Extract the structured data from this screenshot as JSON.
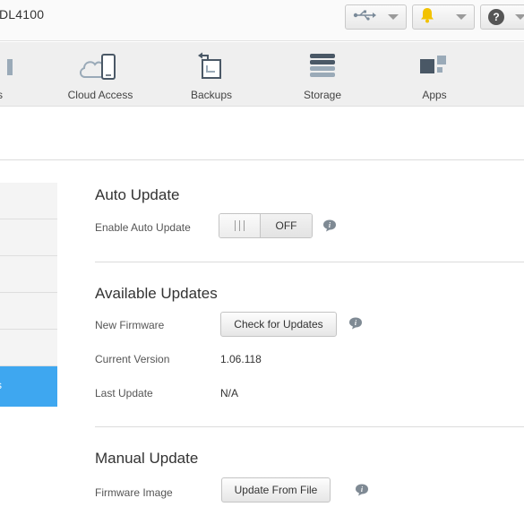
{
  "header": {
    "device_name": "' DL4100"
  },
  "nav": {
    "items": [
      {
        "label": "s"
      },
      {
        "label": "Cloud Access"
      },
      {
        "label": "Backups"
      },
      {
        "label": "Storage"
      },
      {
        "label": "Apps"
      }
    ]
  },
  "sidebar": {
    "active_label": "s"
  },
  "auto_update": {
    "title": "Auto Update",
    "enable_label": "Enable Auto Update",
    "toggle_state": "OFF"
  },
  "available_updates": {
    "title": "Available Updates",
    "new_firmware_label": "New Firmware",
    "check_button": "Check for Updates",
    "current_version_label": "Current Version",
    "current_version_value": "1.06.118",
    "last_update_label": "Last Update",
    "last_update_value": "N/A"
  },
  "manual_update": {
    "title": "Manual Update",
    "firmware_image_label": "Firmware Image",
    "update_button": "Update From File"
  },
  "colors": {
    "accent": "#3ea7f0",
    "bell": "#f2c200",
    "usb_icon": "#7a8a99"
  }
}
